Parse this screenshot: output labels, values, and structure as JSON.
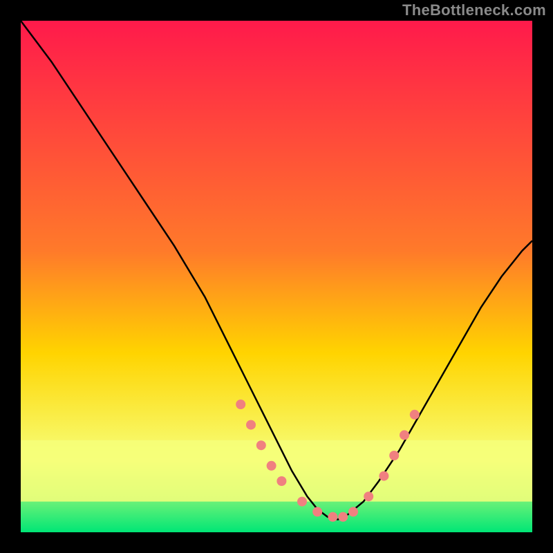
{
  "attribution": "TheBottleneck.com",
  "chart_data": {
    "type": "line",
    "title": "",
    "xlabel": "",
    "ylabel": "",
    "xlim": [
      0,
      100
    ],
    "ylim": [
      0,
      100
    ],
    "grid": false,
    "legend": false,
    "background_gradient": {
      "top_color": "#ff1a4b",
      "mid_color": "#ffd400",
      "bottom_color": "#00e676",
      "bottom_band_color": "#f6ff7a"
    },
    "curves": [
      {
        "name": "left-branch",
        "x": [
          0,
          6,
          12,
          18,
          24,
          30,
          36,
          40,
          44,
          47,
          50,
          53,
          56,
          58,
          60,
          62
        ],
        "y": [
          100,
          92,
          83,
          74,
          65,
          56,
          46,
          38,
          30,
          24,
          18,
          12,
          7,
          4.5,
          3,
          2.5
        ]
      },
      {
        "name": "right-branch",
        "x": [
          62,
          64,
          67,
          70,
          74,
          78,
          82,
          86,
          90,
          94,
          98,
          100
        ],
        "y": [
          2.5,
          3.5,
          6,
          10,
          16,
          23,
          30,
          37,
          44,
          50,
          55,
          57
        ]
      }
    ],
    "dots": {
      "x": [
        43,
        45,
        47,
        49,
        51,
        55,
        58,
        61,
        63,
        65,
        68,
        71,
        73,
        75,
        77
      ],
      "y": [
        25,
        21,
        17,
        13,
        10,
        6,
        4,
        3,
        3,
        4,
        7,
        11,
        15,
        19,
        23
      ],
      "color": "#f08080",
      "radius": 7
    }
  }
}
